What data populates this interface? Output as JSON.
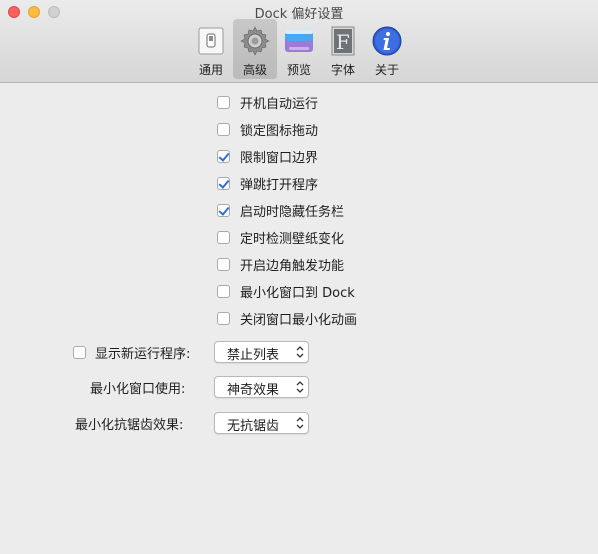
{
  "window": {
    "title": "Dock 偏好设置"
  },
  "toolbar": {
    "items": [
      {
        "label": "通用",
        "icon": "general-switch-icon",
        "selected": false
      },
      {
        "label": "高级",
        "icon": "gear-icon",
        "selected": true
      },
      {
        "label": "预览",
        "icon": "preview-window-icon",
        "selected": false
      },
      {
        "label": "字体",
        "icon": "font-icon",
        "selected": false
      },
      {
        "label": "关于",
        "icon": "info-icon",
        "selected": false
      }
    ]
  },
  "options": [
    {
      "label": "开机自动运行",
      "checked": false
    },
    {
      "label": "锁定图标拖动",
      "checked": false
    },
    {
      "label": "限制窗口边界",
      "checked": true
    },
    {
      "label": "弹跳打开程序",
      "checked": true
    },
    {
      "label": "启动时隐藏任务栏",
      "checked": true
    },
    {
      "label": "定时检测壁纸变化",
      "checked": false
    },
    {
      "label": "开启边角触发功能",
      "checked": false
    },
    {
      "label": "最小化窗口到 Dock",
      "checked": false
    },
    {
      "label": "关闭窗口最小化动画",
      "checked": false
    }
  ],
  "settings": {
    "show_new_apps": {
      "label": "显示新运行程序:",
      "checked": false,
      "value": "禁止列表"
    },
    "minimize_effect": {
      "label": "最小化窗口使用:",
      "value": "神奇效果"
    },
    "antialias": {
      "label": "最小化抗锯齿效果:",
      "value": "无抗锯齿"
    }
  },
  "colors": {
    "accent": "#2f6fd6",
    "close": "#fc605c",
    "minimize": "#fdbc40",
    "zoom_disabled": "#d0d0d0"
  }
}
